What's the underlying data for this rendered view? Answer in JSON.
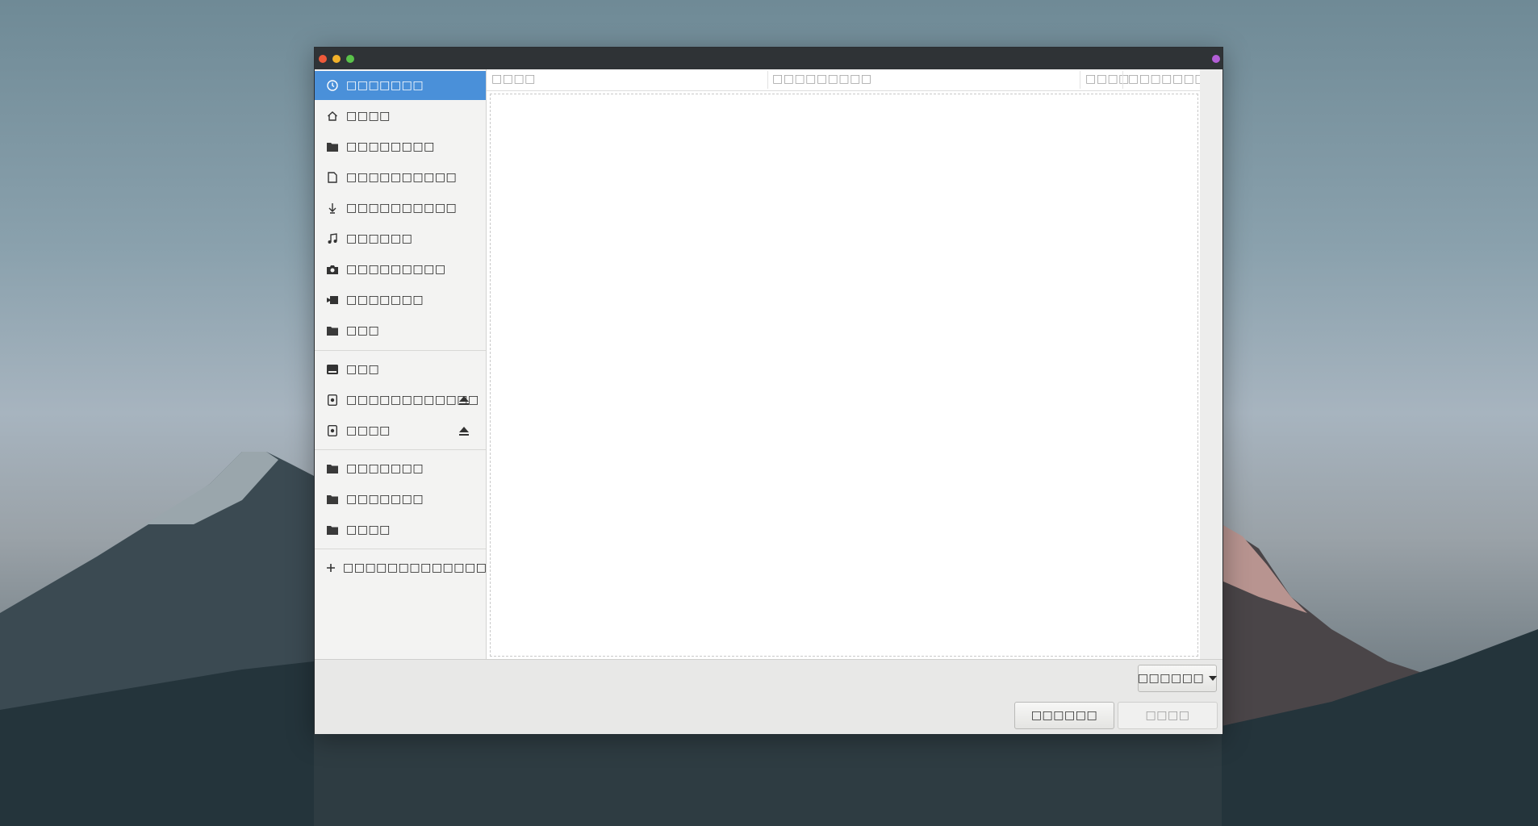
{
  "window": {
    "title_bar_buttons": [
      "close",
      "minimize",
      "maximize"
    ]
  },
  "sidebar": {
    "places": [
      {
        "label": "□□□□□□□",
        "icon": "clock-icon",
        "active": true
      },
      {
        "label": "□□□□",
        "icon": "home-icon"
      },
      {
        "label": "□□□□□□□□",
        "icon": "folder-icon"
      },
      {
        "label": "□□□□□□□□□□",
        "icon": "document-icon"
      },
      {
        "label": "□□□□□□□□□□",
        "icon": "download-icon"
      },
      {
        "label": "□□□□□□",
        "icon": "music-icon"
      },
      {
        "label": "□□□□□□□□□",
        "icon": "camera-icon"
      },
      {
        "label": "□□□□□□□",
        "icon": "video-icon"
      },
      {
        "label": "□□□",
        "icon": "folder-icon"
      }
    ],
    "devices": [
      {
        "label": "□□□",
        "icon": "drive-icon"
      },
      {
        "label": "□□□□□□□□□□□□",
        "icon": "removable-drive-icon",
        "eject": true
      },
      {
        "label": "□□□□",
        "icon": "removable-drive-icon",
        "eject": true
      }
    ],
    "bookmarks": [
      {
        "label": "□□□□□□□",
        "icon": "folder-icon"
      },
      {
        "label": "□□□□□□□",
        "icon": "folder-icon"
      },
      {
        "label": "□□□□",
        "icon": "folder-icon"
      }
    ],
    "other": {
      "label": "□□□□□□□□□□□□□□□□□",
      "icon": "plus-icon"
    }
  },
  "file_list": {
    "columns": [
      "□□□□",
      "□□□□□□□□□",
      "□□□□",
      "□□□□□□□□"
    ]
  },
  "footer": {
    "filter_label": "□□□□□□",
    "cancel_label": "□□□□□□",
    "open_label": "□□□□"
  }
}
